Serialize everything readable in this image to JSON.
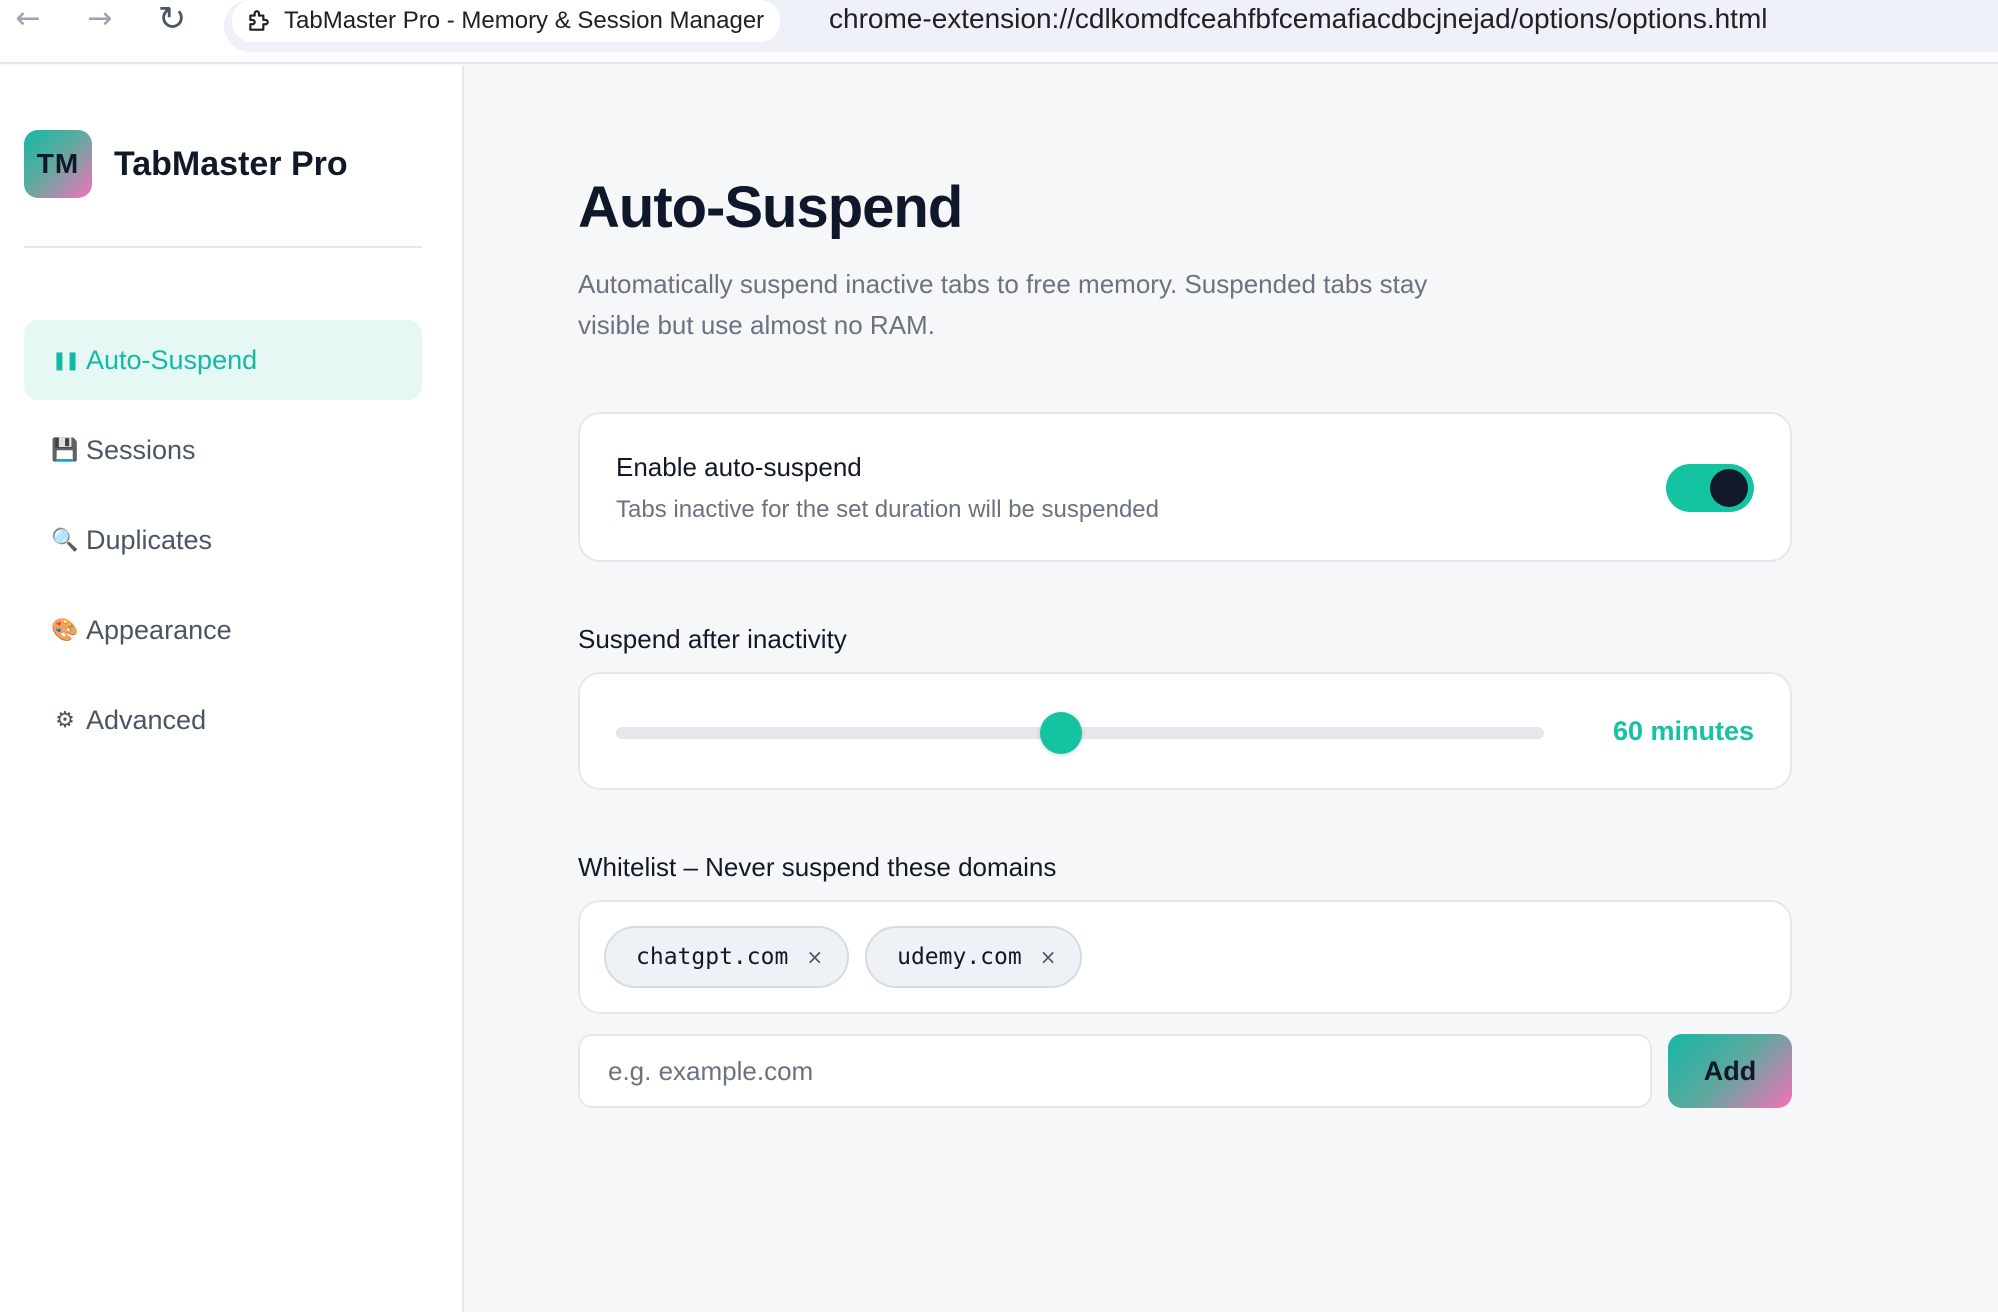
{
  "browser": {
    "back_icon": "arrow-left-icon",
    "forward_icon": "arrow-right-icon",
    "reload_icon": "reload-icon",
    "tab_title": "TabMaster Pro - Memory & Session Manager",
    "url": "chrome-extension://cdlkomdfceahfbfcemafiacdbcjnejad/options/options.html"
  },
  "sidebar": {
    "logo_text": "TM",
    "brand_name": "TabMaster Pro",
    "items": [
      {
        "icon": "❚❚",
        "icon_name": "pause-icon",
        "label": "Auto-Suspend",
        "active": true
      },
      {
        "icon": "💾",
        "icon_name": "floppy-disk-icon",
        "label": "Sessions",
        "active": false
      },
      {
        "icon": "🔍",
        "icon_name": "magnifier-icon",
        "label": "Duplicates",
        "active": false
      },
      {
        "icon": "🎨",
        "icon_name": "palette-icon",
        "label": "Appearance",
        "active": false
      },
      {
        "icon": "⚙",
        "icon_name": "gear-icon",
        "label": "Advanced",
        "active": false
      }
    ]
  },
  "main": {
    "title": "Auto-Suspend",
    "description": "Automatically suspend inactive tabs to free memory. Suspended tabs stay visible but use almost no RAM.",
    "toggle": {
      "title": "Enable auto-suspend",
      "subtitle": "Tabs inactive for the set duration will be suspended",
      "enabled": true
    },
    "slider": {
      "label": "Suspend after inactivity",
      "position_fraction": 0.48,
      "value_text": "60 minutes"
    },
    "whitelist": {
      "label": "Whitelist – Never suspend these domains",
      "domains": [
        "chatgpt.com",
        "udemy.com"
      ],
      "remove_glyph": "×",
      "input_placeholder": "e.g. example.com",
      "input_value": "",
      "add_label": "Add"
    }
  },
  "colors": {
    "accent": "#14c3a2",
    "active_nav_bg": "#e6f8f4",
    "knob": "#111827"
  }
}
